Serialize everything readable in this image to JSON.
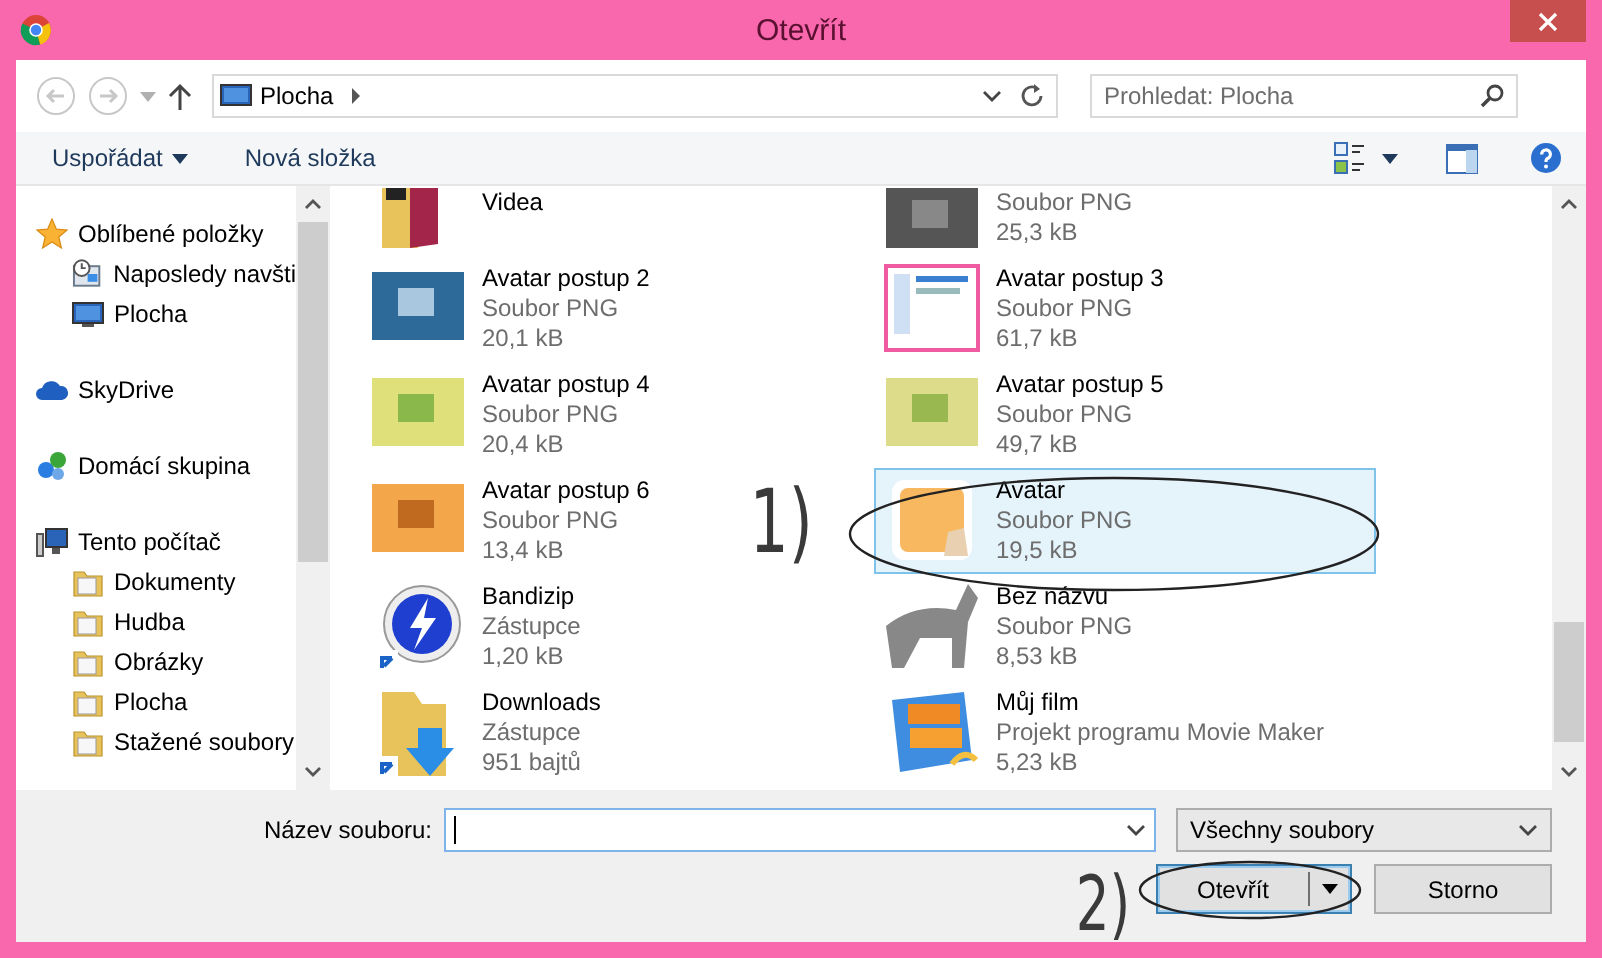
{
  "window": {
    "title": "Otevřít"
  },
  "nav": {
    "path": [
      "Plocha"
    ],
    "search": {
      "placeholder": "Prohledat: Plocha"
    }
  },
  "toolbar": {
    "organize": "Uspořádat",
    "new_folder": "Nová složka"
  },
  "sidebar": {
    "items": [
      {
        "label": "Oblíbené položky",
        "kind": "star",
        "children": [
          {
            "label": "Naposledy navšti",
            "kind": "recent"
          },
          {
            "label": "Plocha",
            "kind": "desktop"
          }
        ]
      },
      {
        "label": "SkyDrive",
        "kind": "cloud"
      },
      {
        "label": "Domácí skupina",
        "kind": "homegroup"
      },
      {
        "label": "Tento počítač",
        "kind": "computer",
        "children": [
          {
            "label": "Dokumenty",
            "kind": "folder"
          },
          {
            "label": "Hudba",
            "kind": "folder"
          },
          {
            "label": "Obrázky",
            "kind": "folder"
          },
          {
            "label": "Plocha",
            "kind": "folder"
          },
          {
            "label": "Stažené soubory",
            "kind": "folder"
          }
        ]
      }
    ]
  },
  "files": [
    {
      "name": "Videa",
      "kind": "folder",
      "selected": false
    },
    {
      "type": "Soubor PNG",
      "size": "25,3 kB",
      "kind": "picture",
      "selected": false
    },
    {
      "name": "Avatar postup 2",
      "type": "Soubor PNG",
      "size": "20,1 kB",
      "kind": "picture",
      "selected": false
    },
    {
      "name": "Avatar postup 3",
      "type": "Soubor PNG",
      "size": "61,7 kB",
      "kind": "picture",
      "selected": false
    },
    {
      "name": "Avatar postup 4",
      "type": "Soubor PNG",
      "size": "20,4 kB",
      "kind": "picture",
      "selected": false
    },
    {
      "name": "Avatar postup 5",
      "type": "Soubor PNG",
      "size": "49,7 kB",
      "kind": "picture",
      "selected": false
    },
    {
      "name": "Avatar postup 6",
      "type": "Soubor PNG",
      "size": "13,4 kB",
      "kind": "picture",
      "selected": false
    },
    {
      "name": "Avatar",
      "type": "Soubor PNG",
      "size": "19,5 kB",
      "kind": "picture",
      "selected": true
    },
    {
      "name": "Bandizip",
      "type": "Zástupce",
      "size": "1,20 kB",
      "kind": "app-shortcut",
      "selected": false
    },
    {
      "name": "Bez názvu",
      "type": "Soubor PNG",
      "size": "8,53 kB",
      "kind": "picture",
      "selected": false
    },
    {
      "name": "Downloads",
      "type": "Zástupce",
      "size": "951 bajtů",
      "kind": "folder-shortcut",
      "selected": false
    },
    {
      "name": "Můj film",
      "type": "Projekt programu Movie Maker",
      "size": "5,23 kB",
      "kind": "movie",
      "selected": false
    }
  ],
  "filename": {
    "label": "Název souboru:",
    "focused": true
  },
  "filter": {
    "value": "Všechny soubory"
  },
  "buttons": [
    {
      "label": "Otevřít",
      "kind": "split",
      "default": true
    },
    {
      "label": "Storno",
      "kind": "plain",
      "default": false
    }
  ],
  "annotations": [
    {
      "text": "1)",
      "kind": "file-mark"
    },
    {
      "text": "2)",
      "kind": "button-mark"
    }
  ]
}
